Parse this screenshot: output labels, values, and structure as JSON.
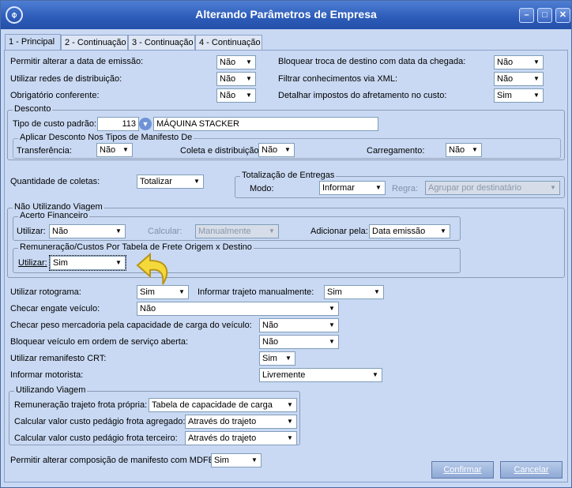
{
  "window": {
    "title": "Alterando Parâmetros de Empresa",
    "logo_icon": "app-logo-icon"
  },
  "tabs": [
    "1 - Principal",
    "2 - Continuação",
    "3 - Continuação",
    "4 - Continuação"
  ],
  "top_left": [
    {
      "label": "Permitir alterar a data de emissão:",
      "value": "Não"
    },
    {
      "label": "Utilizar redes de distribuição:",
      "value": "Não"
    },
    {
      "label": "Obrigatório conferente:",
      "value": "Não"
    }
  ],
  "top_right": [
    {
      "label": "Bloquear troca de destino com data da chegada:",
      "value": "Não"
    },
    {
      "label": "Filtrar conhecimentos via XML:",
      "value": "Não"
    },
    {
      "label": "Detalhar impostos do afretamento no custo:",
      "value": "Sim"
    }
  ],
  "desconto": {
    "title": "Desconto",
    "tipo_label": "Tipo de custo padrão:",
    "tipo_code": "113",
    "tipo_desc": "MÁQUINA STACKER",
    "aplicar": {
      "title": "Aplicar Desconto Nos Tipos de Manifesto De",
      "transferencia_label": "Transferência:",
      "transferencia_value": "Não",
      "coleta_label": "Coleta e distribuição:",
      "coleta_value": "Não",
      "carregamento_label": "Carregamento:",
      "carregamento_value": "Não"
    }
  },
  "coletas": {
    "label": "Quantidade de coletas:",
    "value": "Totalizar"
  },
  "totalizacao": {
    "title": "Totalização de Entregas",
    "modo_label": "Modo:",
    "modo_value": "Informar",
    "regra_label": "Regra:",
    "regra_value": "Agrupar por destinatário"
  },
  "nao_viagem": {
    "title": "Não Utilizando Viagem",
    "acerto": {
      "title": "Acerto Financeiro",
      "utilizar_label": "Utilizar:",
      "utilizar_value": "Não",
      "calcular_label": "Calcular:",
      "calcular_value": "Manualmente",
      "adicionar_label": "Adicionar pela:",
      "adicionar_value": "Data emissão"
    },
    "remuneracao": {
      "title": "Remuneração/Custos Por Tabela de Frete Origem x Destino",
      "utilizar_label": "Utilizar:",
      "utilizar_value": "Sim"
    }
  },
  "rotograma": {
    "label": "Utilizar rotograma:",
    "value": "Sim"
  },
  "trajeto": {
    "label": "Informar trajeto manualmente:",
    "value": "Sim"
  },
  "engate": {
    "label": "Checar engate veículo:",
    "value": "Não"
  },
  "peso": {
    "label": "Checar peso mercadoria pela capacidade de carga do veículo:",
    "value": "Não"
  },
  "bloquear": {
    "label": "Bloquear veículo em ordem de serviço aberta:",
    "value": "Não"
  },
  "remanifesto": {
    "label": "Utilizar remanifesto CRT:",
    "value": "Sim"
  },
  "motorista": {
    "label": "Informar motorista:",
    "value": "Livremente"
  },
  "viagem": {
    "title": "Utilizando Viagem",
    "rows": [
      {
        "label": "Remuneração trajeto frota própria:",
        "value": "Tabela de capacidade de carga"
      },
      {
        "label": "Calcular valor custo pedágio frota agregado:",
        "value": "Através do trajeto"
      },
      {
        "label": "Calcular valor custo pedágio frota terceiro:",
        "value": "Através do trajeto"
      }
    ]
  },
  "mdfe": {
    "label": "Permitir alterar composição de manifesto com MDFE:",
    "value": "Sim"
  },
  "buttons": {
    "confirmar": "Confirmar",
    "cancelar": "Cancelar"
  },
  "colors": {
    "title_bar": "#2c5bb8",
    "panel": "#c9d9f3",
    "highlight_arrow": "#f5d83a"
  }
}
